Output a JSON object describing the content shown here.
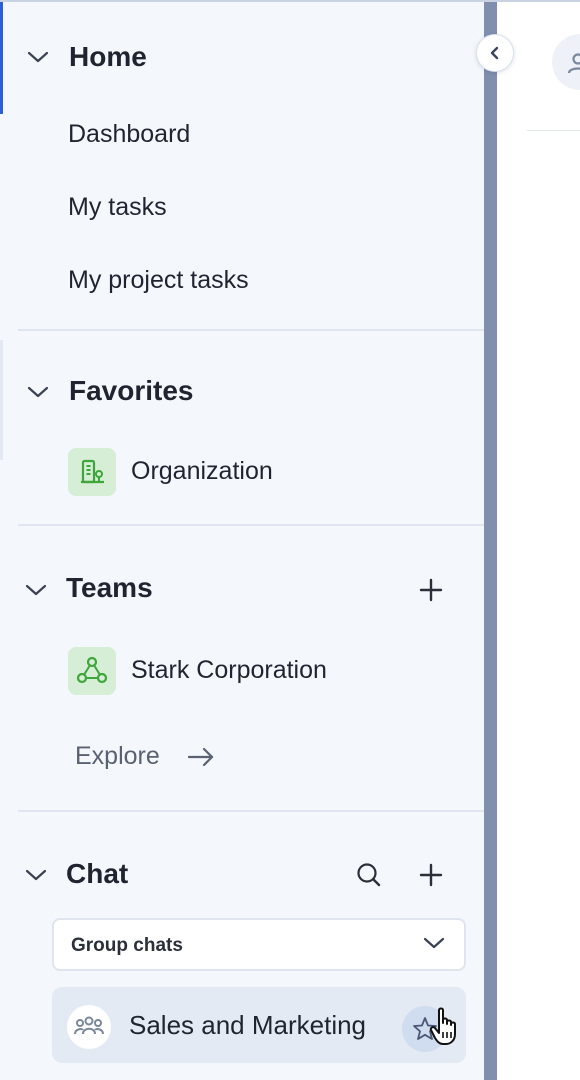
{
  "sidebar": {
    "home": {
      "title": "Home",
      "items": [
        "Dashboard",
        "My tasks",
        "My project tasks"
      ]
    },
    "favorites": {
      "title": "Favorites",
      "items": [
        {
          "label": "Organization",
          "icon": "organization-icon"
        }
      ]
    },
    "teams": {
      "title": "Teams",
      "items": [
        {
          "label": "Stark Corporation",
          "icon": "team-network-icon"
        }
      ],
      "explore_label": "Explore"
    },
    "chat": {
      "title": "Chat",
      "filter": {
        "selected": "Group chats"
      },
      "items": [
        {
          "label": "Sales and Marketing",
          "icon": "group-icon"
        }
      ]
    }
  },
  "colors": {
    "sidebar_bg": "#f4f7fc",
    "badge_bg": "#d6eed5",
    "badge_icon": "#3ea63a",
    "scrollbar": "#7f8fad",
    "active_item_bg": "#e4eaf3"
  }
}
